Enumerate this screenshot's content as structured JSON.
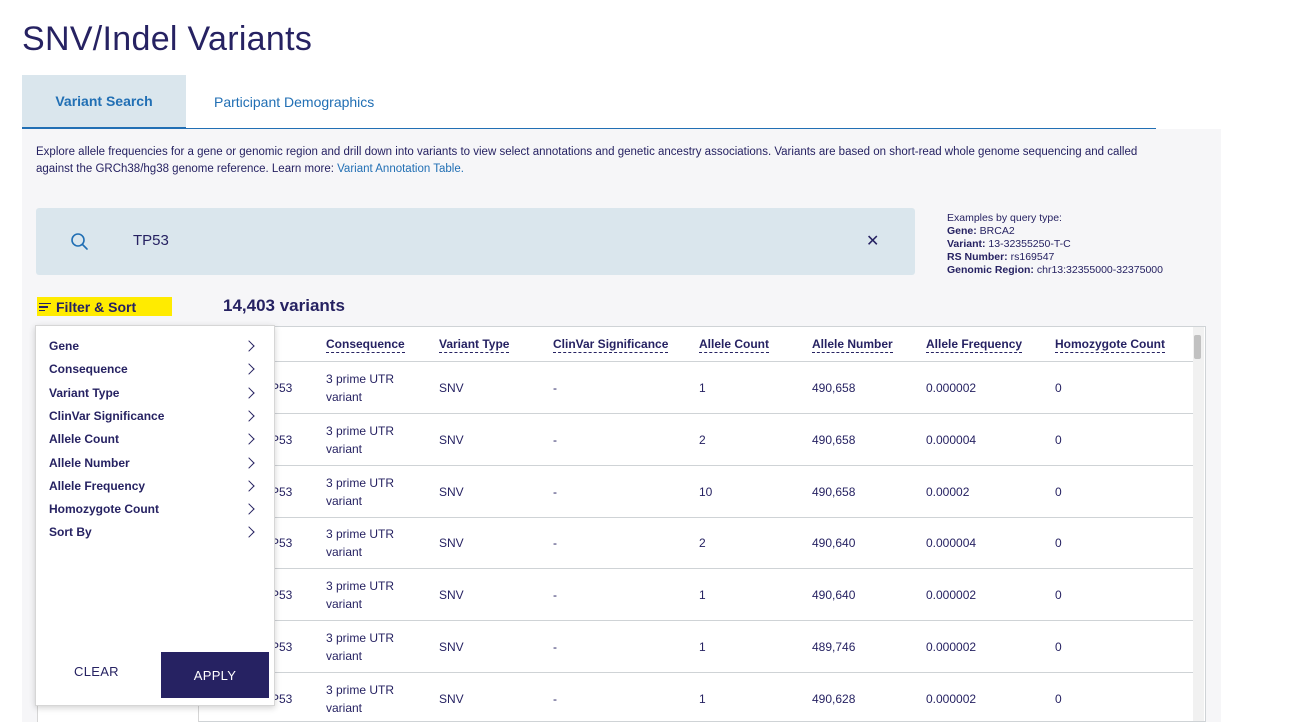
{
  "page": {
    "title": "SNV/Indel Variants"
  },
  "tabs": [
    {
      "label": "Variant Search",
      "active": true
    },
    {
      "label": "Participant Demographics",
      "active": false
    }
  ],
  "description": {
    "text": "Explore allele frequencies for a gene or genomic region and drill down into variants to view select annotations and genetic ancestry associations. Variants are based on short-read whole genome sequencing and called against the GRCh38/hg38 genome reference. Learn more: ",
    "link": "Variant Annotation Table."
  },
  "search": {
    "value": "TP53",
    "icon": "search-icon",
    "clear_label": "✕"
  },
  "examples": {
    "heading": "Examples by query type:",
    "items": [
      {
        "label": "Gene:",
        "value": " BRCA2"
      },
      {
        "label": "Variant:",
        "value": " 13-32355250-T-C"
      },
      {
        "label": "RS Number:",
        "value": " rs169547"
      },
      {
        "label": "Genomic Region:",
        "value": " chr13:32355000-32375000"
      }
    ]
  },
  "filter": {
    "label": "Filter & Sort",
    "highlight_color": "#ffeb00",
    "menu": [
      "Gene",
      "Consequence",
      "Variant Type",
      "ClinVar Significance",
      "Allele Count",
      "Allele Number",
      "Allele Frequency",
      "Homozygote Count",
      "Sort By"
    ],
    "clear_label": "CLEAR",
    "apply_label": "APPLY"
  },
  "results": {
    "count_label": "14,403 variants"
  },
  "table": {
    "columns": [
      "Consequence",
      "Variant Type",
      "ClinVar Significance",
      "Allele Count",
      "Allele Number",
      "Allele Frequency",
      "Homozygote Count"
    ],
    "rows": [
      {
        "gene": "P53",
        "consequence_1": "3 prime UTR",
        "consequence_2": "variant",
        "type": "SNV",
        "clinvar": "-",
        "allele_count": "1",
        "allele_number": "490,658",
        "allele_frequency": "0.000002",
        "homozygote_count": "0"
      },
      {
        "gene": "P53",
        "consequence_1": "3 prime UTR",
        "consequence_2": "variant",
        "type": "SNV",
        "clinvar": "-",
        "allele_count": "2",
        "allele_number": "490,658",
        "allele_frequency": "0.000004",
        "homozygote_count": "0"
      },
      {
        "gene": "P53",
        "consequence_1": "3 prime UTR",
        "consequence_2": "variant",
        "type": "SNV",
        "clinvar": "-",
        "allele_count": "10",
        "allele_number": "490,658",
        "allele_frequency": "0.00002",
        "homozygote_count": "0"
      },
      {
        "gene": "P53",
        "consequence_1": "3 prime UTR",
        "consequence_2": "variant",
        "type": "SNV",
        "clinvar": "-",
        "allele_count": "2",
        "allele_number": "490,640",
        "allele_frequency": "0.000004",
        "homozygote_count": "0"
      },
      {
        "gene": "P53",
        "consequence_1": "3 prime UTR",
        "consequence_2": "variant",
        "type": "SNV",
        "clinvar": "-",
        "allele_count": "1",
        "allele_number": "490,640",
        "allele_frequency": "0.000002",
        "homozygote_count": "0"
      },
      {
        "gene": "P53",
        "consequence_1": "3 prime UTR",
        "consequence_2": "variant",
        "type": "SNV",
        "clinvar": "-",
        "allele_count": "1",
        "allele_number": "489,746",
        "allele_frequency": "0.000002",
        "homozygote_count": "0"
      },
      {
        "gene": "P53",
        "consequence_1": "3 prime UTR",
        "consequence_2": "variant",
        "type": "SNV",
        "clinvar": "-",
        "allele_count": "1",
        "allele_number": "490,628",
        "allele_frequency": "0.000002",
        "homozygote_count": "0"
      }
    ]
  },
  "colors": {
    "primary": "#262262",
    "accent": "#216fb4",
    "search_bg": "#dae6ed",
    "panel_bg": "#f6f6f8"
  }
}
